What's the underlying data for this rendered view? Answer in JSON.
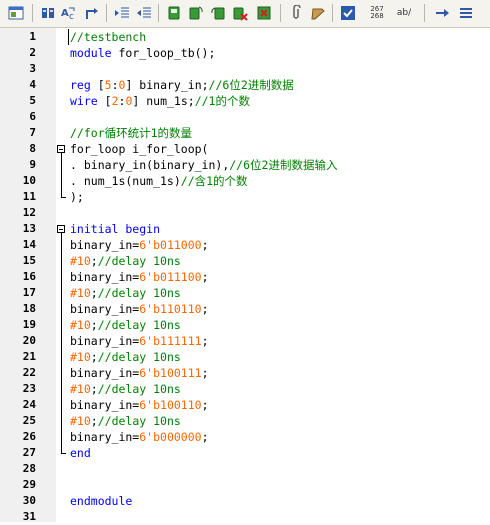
{
  "toolbar": {
    "buttons": [
      {
        "name": "view-icon"
      },
      {
        "name": "macro-icon"
      },
      {
        "name": "replace-icon"
      },
      {
        "name": "goto-icon"
      },
      {
        "name": "indent-icon"
      },
      {
        "name": "outdent-icon"
      },
      {
        "name": "fold-icon"
      },
      {
        "name": "refresh-icon"
      },
      {
        "name": "undo-icon"
      },
      {
        "name": "delete-icon"
      },
      {
        "name": "close-file-icon"
      },
      {
        "name": "paperclip-icon"
      },
      {
        "name": "wrap-icon"
      },
      {
        "name": "spellcheck-icon"
      }
    ],
    "counter_top": "267",
    "counter_bottom": "268",
    "ab_label": "ab/",
    "trailing": [
      {
        "name": "arrow-right-icon"
      },
      {
        "name": "list-icon"
      }
    ]
  },
  "editor": {
    "lines": [
      {
        "n": "1",
        "tokens": [
          {
            "t": "//testbench",
            "c": "comment"
          }
        ]
      },
      {
        "n": "2",
        "tokens": [
          {
            "t": "module",
            "c": "keyword"
          },
          {
            "t": " for_loop_tb();",
            "c": "plain"
          }
        ]
      },
      {
        "n": "3",
        "tokens": []
      },
      {
        "n": "4",
        "tokens": [
          {
            "t": "reg",
            "c": "keyword"
          },
          {
            "t": " [",
            "c": "plain"
          },
          {
            "t": "5",
            "c": "number"
          },
          {
            "t": ":",
            "c": "plain"
          },
          {
            "t": "0",
            "c": "number"
          },
          {
            "t": "] binary_in;",
            "c": "plain"
          },
          {
            "t": "//6位2进制数据",
            "c": "comment"
          }
        ]
      },
      {
        "n": "5",
        "tokens": [
          {
            "t": "wire",
            "c": "keyword"
          },
          {
            "t": " [",
            "c": "plain"
          },
          {
            "t": "2",
            "c": "number"
          },
          {
            "t": ":",
            "c": "plain"
          },
          {
            "t": "0",
            "c": "number"
          },
          {
            "t": "] num_1s;",
            "c": "plain"
          },
          {
            "t": "//1的个数",
            "c": "comment"
          }
        ]
      },
      {
        "n": "6",
        "tokens": []
      },
      {
        "n": "7",
        "tokens": [
          {
            "t": "//for循环统计1的数量",
            "c": "comment"
          }
        ]
      },
      {
        "n": "8",
        "fold": "start",
        "tokens": [
          {
            "t": "for_loop i_for_loop(",
            "c": "plain"
          }
        ]
      },
      {
        "n": "9",
        "tokens": [
          {
            "t": ". binary_in(binary_in),",
            "c": "plain"
          },
          {
            "t": "//6位2进制数据输入",
            "c": "comment"
          }
        ]
      },
      {
        "n": "10",
        "tokens": [
          {
            "t": ". num_1s(num_1s)",
            "c": "plain"
          },
          {
            "t": "//含1的个数",
            "c": "comment"
          }
        ]
      },
      {
        "n": "11",
        "fold": "end",
        "tokens": [
          {
            "t": ");",
            "c": "plain"
          }
        ]
      },
      {
        "n": "12",
        "tokens": []
      },
      {
        "n": "13",
        "fold": "start",
        "tokens": [
          {
            "t": "initial begin",
            "c": "keyword"
          }
        ]
      },
      {
        "n": "14",
        "tokens": [
          {
            "t": "binary_in=",
            "c": "plain"
          },
          {
            "t": "6'b011000",
            "c": "number"
          },
          {
            "t": ";",
            "c": "plain"
          }
        ]
      },
      {
        "n": "15",
        "tokens": [
          {
            "t": "#10",
            "c": "number"
          },
          {
            "t": ";",
            "c": "plain"
          },
          {
            "t": "//delay 10ns",
            "c": "comment"
          }
        ]
      },
      {
        "n": "16",
        "tokens": [
          {
            "t": "binary_in=",
            "c": "plain"
          },
          {
            "t": "6'b011100",
            "c": "number"
          },
          {
            "t": ";",
            "c": "plain"
          }
        ]
      },
      {
        "n": "17",
        "tokens": [
          {
            "t": "#10",
            "c": "number"
          },
          {
            "t": ";",
            "c": "plain"
          },
          {
            "t": "//delay 10ns",
            "c": "comment"
          }
        ]
      },
      {
        "n": "18",
        "tokens": [
          {
            "t": "binary_in=",
            "c": "plain"
          },
          {
            "t": "6'b110110",
            "c": "number"
          },
          {
            "t": ";",
            "c": "plain"
          }
        ]
      },
      {
        "n": "19",
        "tokens": [
          {
            "t": "#10",
            "c": "number"
          },
          {
            "t": ";",
            "c": "plain"
          },
          {
            "t": "//delay 10ns",
            "c": "comment"
          }
        ]
      },
      {
        "n": "20",
        "tokens": [
          {
            "t": "binary_in=",
            "c": "plain"
          },
          {
            "t": "6'b111111",
            "c": "number"
          },
          {
            "t": ";",
            "c": "plain"
          }
        ]
      },
      {
        "n": "21",
        "tokens": [
          {
            "t": "#10",
            "c": "number"
          },
          {
            "t": ";",
            "c": "plain"
          },
          {
            "t": "//delay 10ns",
            "c": "comment"
          }
        ]
      },
      {
        "n": "22",
        "tokens": [
          {
            "t": "binary_in=",
            "c": "plain"
          },
          {
            "t": "6'b100111",
            "c": "number"
          },
          {
            "t": ";",
            "c": "plain"
          }
        ]
      },
      {
        "n": "23",
        "tokens": [
          {
            "t": "#10",
            "c": "number"
          },
          {
            "t": ";",
            "c": "plain"
          },
          {
            "t": "//delay 10ns",
            "c": "comment"
          }
        ]
      },
      {
        "n": "24",
        "tokens": [
          {
            "t": "binary_in=",
            "c": "plain"
          },
          {
            "t": "6'b100110",
            "c": "number"
          },
          {
            "t": ";",
            "c": "plain"
          }
        ]
      },
      {
        "n": "25",
        "tokens": [
          {
            "t": "#10",
            "c": "number"
          },
          {
            "t": ";",
            "c": "plain"
          },
          {
            "t": "//delay 10ns",
            "c": "comment"
          }
        ]
      },
      {
        "n": "26",
        "tokens": [
          {
            "t": "binary_in=",
            "c": "plain"
          },
          {
            "t": "6'b000000",
            "c": "number"
          },
          {
            "t": ";",
            "c": "plain"
          }
        ]
      },
      {
        "n": "27",
        "fold": "end",
        "tokens": [
          {
            "t": "end",
            "c": "keyword"
          }
        ]
      },
      {
        "n": "28",
        "tokens": []
      },
      {
        "n": "29",
        "tokens": []
      },
      {
        "n": "30",
        "tokens": [
          {
            "t": "endmodule",
            "c": "keyword"
          }
        ]
      },
      {
        "n": "31",
        "tokens": []
      }
    ]
  },
  "colors": {
    "comment": "#008000",
    "keyword": "#0000ff",
    "number": "#ff6600",
    "plain": "#000000"
  }
}
